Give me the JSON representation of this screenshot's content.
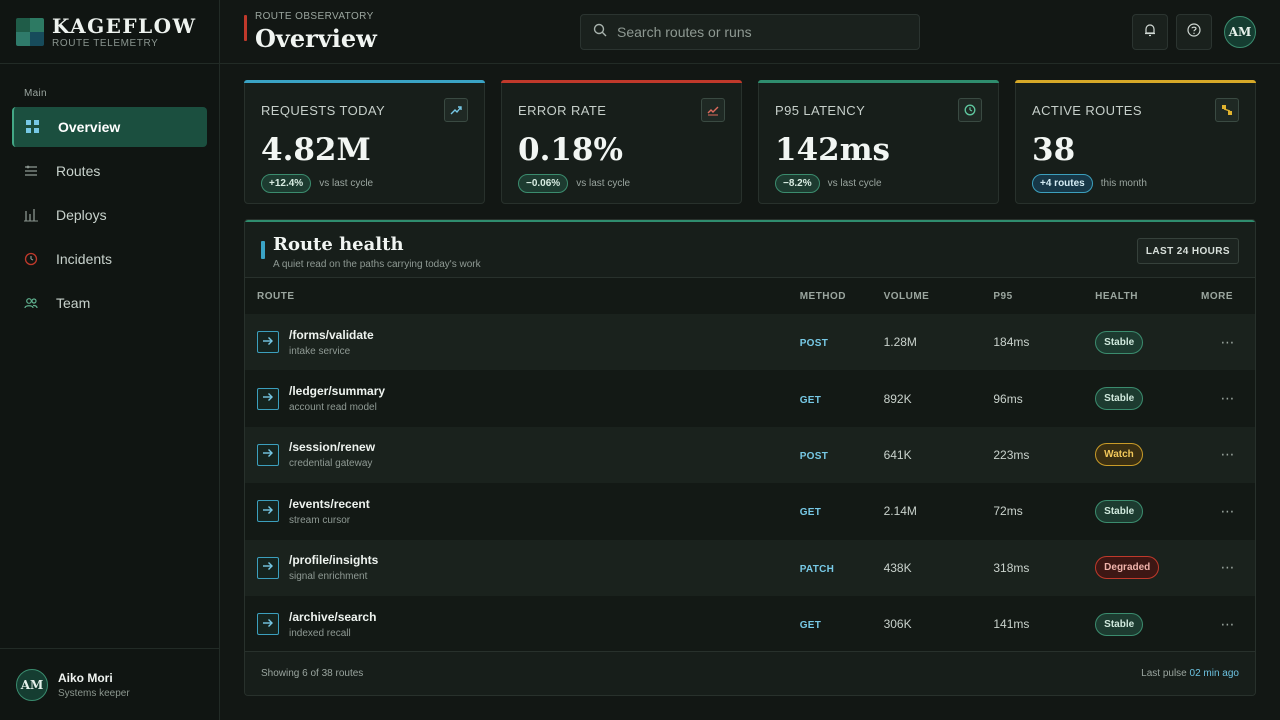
{
  "brand": {
    "name": "KAGEFLOW",
    "subtitle": "ROUTE TELEMETRY"
  },
  "sidebar": {
    "section_label": "Main",
    "items": [
      {
        "label": "Overview",
        "icon": "grid-icon",
        "active": true
      },
      {
        "label": "Routes",
        "icon": "routes-icon",
        "active": false
      },
      {
        "label": "Deploys",
        "icon": "bar-chart-icon",
        "active": false
      },
      {
        "label": "Incidents",
        "icon": "clock-icon",
        "active": false
      },
      {
        "label": "Team",
        "icon": "users-icon",
        "active": false
      }
    ],
    "profile": {
      "initials": "AM",
      "name": "Aiko Mori",
      "role": "Systems keeper"
    }
  },
  "header": {
    "eyebrow": "ROUTE OBSERVATORY",
    "title": "Overview",
    "search_placeholder": "Search routes or runs",
    "user_initials": "AM"
  },
  "stats": [
    {
      "label": "REQUESTS TODAY",
      "value": "4.82M",
      "delta": "+12.4%",
      "note": "vs last cycle",
      "accent": "#3aa3c5",
      "icon": "trend-up-icon"
    },
    {
      "label": "ERROR RATE",
      "value": "0.18%",
      "delta": "−0.06%",
      "note": "vs last cycle",
      "accent": "#c0392b",
      "icon": "line-chart-icon"
    },
    {
      "label": "P95 LATENCY",
      "value": "142ms",
      "delta": "−8.2%",
      "note": "vs last cycle",
      "accent": "#2f8d6e",
      "icon": "clock-icon"
    },
    {
      "label": "ACTIVE ROUTES",
      "value": "38",
      "delta": "+4 routes",
      "note": "this month",
      "accent": "#d6a928",
      "icon": "nodes-icon"
    }
  ],
  "panel": {
    "title": "Route health",
    "subtitle": "A quiet read on the paths carrying today's work",
    "range_label": "LAST 24 HOURS",
    "columns": [
      "ROUTE",
      "METHOD",
      "VOLUME",
      "P95",
      "HEALTH",
      "MORE"
    ],
    "rows": [
      {
        "path": "/forms/validate",
        "desc": "intake service",
        "method": "POST",
        "volume": "1.28M",
        "p95": "184ms",
        "health": "Stable"
      },
      {
        "path": "/ledger/summary",
        "desc": "account read model",
        "method": "GET",
        "volume": "892K",
        "p95": "96ms",
        "health": "Stable"
      },
      {
        "path": "/session/renew",
        "desc": "credential gateway",
        "method": "POST",
        "volume": "641K",
        "p95": "223ms",
        "health": "Watch"
      },
      {
        "path": "/events/recent",
        "desc": "stream cursor",
        "method": "GET",
        "volume": "2.14M",
        "p95": "72ms",
        "health": "Stable"
      },
      {
        "path": "/profile/insights",
        "desc": "signal enrichment",
        "method": "PATCH",
        "volume": "438K",
        "p95": "318ms",
        "health": "Degraded"
      },
      {
        "path": "/archive/search",
        "desc": "indexed recall",
        "method": "GET",
        "volume": "306K",
        "p95": "141ms",
        "health": "Stable"
      }
    ],
    "footer_left": "Showing 6 of 38 routes",
    "footer_pulse_label": "Last pulse",
    "footer_pulse_time": "02 min ago"
  }
}
